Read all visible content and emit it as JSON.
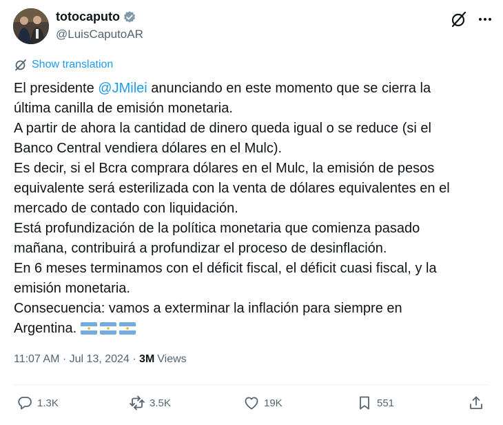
{
  "author": {
    "display_name": "totocaputo",
    "handle": "@LuisCaputoAR",
    "verified": true
  },
  "translate_label": "Show translation",
  "body": {
    "l1_pre": "El presidente ",
    "l1_mention": "@JMilei",
    "l1_post": " anunciando en este momento que se cierra la",
    "l2": "última canilla de emisión monetaria.",
    "l3": "A partir de ahora la cantidad de dinero queda igual o se reduce (si el",
    "l4": "Banco Central vendiera dólares en el Mulc).",
    "l5": "Es decir, si el Bcra comprara dólares en el Mulc, la emisión de pesos",
    "l6": "equivalente será esterilizada con la venta de dólares equivalentes en el",
    "l7": "mercado de contado con liquidación.",
    "l8": "Está profundización de la política monetaria que comienza pasado",
    "l9": "mañana, contribuirá a profundizar el proceso de desinflación.",
    "l10": "En 6 meses terminamos con el déficit fiscal, el déficit cuasi fiscal, y la",
    "l11": "emisión monetaria.",
    "l12": "Consecuencia:  vamos a exterminar la inflación para siempre en",
    "l13": "Argentina."
  },
  "meta": {
    "time": "11:07 AM",
    "separator": " · ",
    "date": "Jul 13, 2024",
    "separator2": " · ",
    "views_count": "3M",
    "views_label": "Views"
  },
  "actions": {
    "replies": "1.3K",
    "reposts": "3.5K",
    "likes": "19K",
    "bookmarks": "551"
  },
  "colors": {
    "accent": "#1d9bf0",
    "text": "#0f1419",
    "secondary": "#536471",
    "flag_blue": "#74acdf",
    "flag_sun": "#f6b40e"
  },
  "icons": [
    "verified-badge-icon",
    "grok-icon",
    "more-icon",
    "translate-icon",
    "argentina-flag-icon",
    "reply-icon",
    "repost-icon",
    "like-icon",
    "bookmark-icon",
    "share-icon"
  ]
}
